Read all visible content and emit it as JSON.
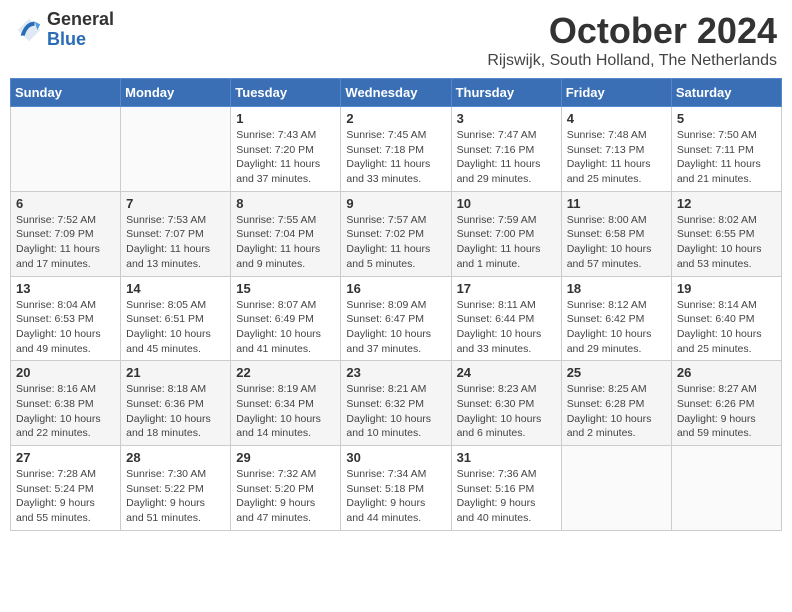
{
  "logo": {
    "general": "General",
    "blue": "Blue"
  },
  "header": {
    "month": "October 2024",
    "location": "Rijswijk, South Holland, The Netherlands"
  },
  "weekdays": [
    "Sunday",
    "Monday",
    "Tuesday",
    "Wednesday",
    "Thursday",
    "Friday",
    "Saturday"
  ],
  "weeks": [
    [
      {
        "day": "",
        "info": ""
      },
      {
        "day": "",
        "info": ""
      },
      {
        "day": "1",
        "info": "Sunrise: 7:43 AM\nSunset: 7:20 PM\nDaylight: 11 hours\nand 37 minutes."
      },
      {
        "day": "2",
        "info": "Sunrise: 7:45 AM\nSunset: 7:18 PM\nDaylight: 11 hours\nand 33 minutes."
      },
      {
        "day": "3",
        "info": "Sunrise: 7:47 AM\nSunset: 7:16 PM\nDaylight: 11 hours\nand 29 minutes."
      },
      {
        "day": "4",
        "info": "Sunrise: 7:48 AM\nSunset: 7:13 PM\nDaylight: 11 hours\nand 25 minutes."
      },
      {
        "day": "5",
        "info": "Sunrise: 7:50 AM\nSunset: 7:11 PM\nDaylight: 11 hours\nand 21 minutes."
      }
    ],
    [
      {
        "day": "6",
        "info": "Sunrise: 7:52 AM\nSunset: 7:09 PM\nDaylight: 11 hours\nand 17 minutes."
      },
      {
        "day": "7",
        "info": "Sunrise: 7:53 AM\nSunset: 7:07 PM\nDaylight: 11 hours\nand 13 minutes."
      },
      {
        "day": "8",
        "info": "Sunrise: 7:55 AM\nSunset: 7:04 PM\nDaylight: 11 hours\nand 9 minutes."
      },
      {
        "day": "9",
        "info": "Sunrise: 7:57 AM\nSunset: 7:02 PM\nDaylight: 11 hours\nand 5 minutes."
      },
      {
        "day": "10",
        "info": "Sunrise: 7:59 AM\nSunset: 7:00 PM\nDaylight: 11 hours\nand 1 minute."
      },
      {
        "day": "11",
        "info": "Sunrise: 8:00 AM\nSunset: 6:58 PM\nDaylight: 10 hours\nand 57 minutes."
      },
      {
        "day": "12",
        "info": "Sunrise: 8:02 AM\nSunset: 6:55 PM\nDaylight: 10 hours\nand 53 minutes."
      }
    ],
    [
      {
        "day": "13",
        "info": "Sunrise: 8:04 AM\nSunset: 6:53 PM\nDaylight: 10 hours\nand 49 minutes."
      },
      {
        "day": "14",
        "info": "Sunrise: 8:05 AM\nSunset: 6:51 PM\nDaylight: 10 hours\nand 45 minutes."
      },
      {
        "day": "15",
        "info": "Sunrise: 8:07 AM\nSunset: 6:49 PM\nDaylight: 10 hours\nand 41 minutes."
      },
      {
        "day": "16",
        "info": "Sunrise: 8:09 AM\nSunset: 6:47 PM\nDaylight: 10 hours\nand 37 minutes."
      },
      {
        "day": "17",
        "info": "Sunrise: 8:11 AM\nSunset: 6:44 PM\nDaylight: 10 hours\nand 33 minutes."
      },
      {
        "day": "18",
        "info": "Sunrise: 8:12 AM\nSunset: 6:42 PM\nDaylight: 10 hours\nand 29 minutes."
      },
      {
        "day": "19",
        "info": "Sunrise: 8:14 AM\nSunset: 6:40 PM\nDaylight: 10 hours\nand 25 minutes."
      }
    ],
    [
      {
        "day": "20",
        "info": "Sunrise: 8:16 AM\nSunset: 6:38 PM\nDaylight: 10 hours\nand 22 minutes."
      },
      {
        "day": "21",
        "info": "Sunrise: 8:18 AM\nSunset: 6:36 PM\nDaylight: 10 hours\nand 18 minutes."
      },
      {
        "day": "22",
        "info": "Sunrise: 8:19 AM\nSunset: 6:34 PM\nDaylight: 10 hours\nand 14 minutes."
      },
      {
        "day": "23",
        "info": "Sunrise: 8:21 AM\nSunset: 6:32 PM\nDaylight: 10 hours\nand 10 minutes."
      },
      {
        "day": "24",
        "info": "Sunrise: 8:23 AM\nSunset: 6:30 PM\nDaylight: 10 hours\nand 6 minutes."
      },
      {
        "day": "25",
        "info": "Sunrise: 8:25 AM\nSunset: 6:28 PM\nDaylight: 10 hours\nand 2 minutes."
      },
      {
        "day": "26",
        "info": "Sunrise: 8:27 AM\nSunset: 6:26 PM\nDaylight: 9 hours\nand 59 minutes."
      }
    ],
    [
      {
        "day": "27",
        "info": "Sunrise: 7:28 AM\nSunset: 5:24 PM\nDaylight: 9 hours\nand 55 minutes."
      },
      {
        "day": "28",
        "info": "Sunrise: 7:30 AM\nSunset: 5:22 PM\nDaylight: 9 hours\nand 51 minutes."
      },
      {
        "day": "29",
        "info": "Sunrise: 7:32 AM\nSunset: 5:20 PM\nDaylight: 9 hours\nand 47 minutes."
      },
      {
        "day": "30",
        "info": "Sunrise: 7:34 AM\nSunset: 5:18 PM\nDaylight: 9 hours\nand 44 minutes."
      },
      {
        "day": "31",
        "info": "Sunrise: 7:36 AM\nSunset: 5:16 PM\nDaylight: 9 hours\nand 40 minutes."
      },
      {
        "day": "",
        "info": ""
      },
      {
        "day": "",
        "info": ""
      }
    ]
  ]
}
